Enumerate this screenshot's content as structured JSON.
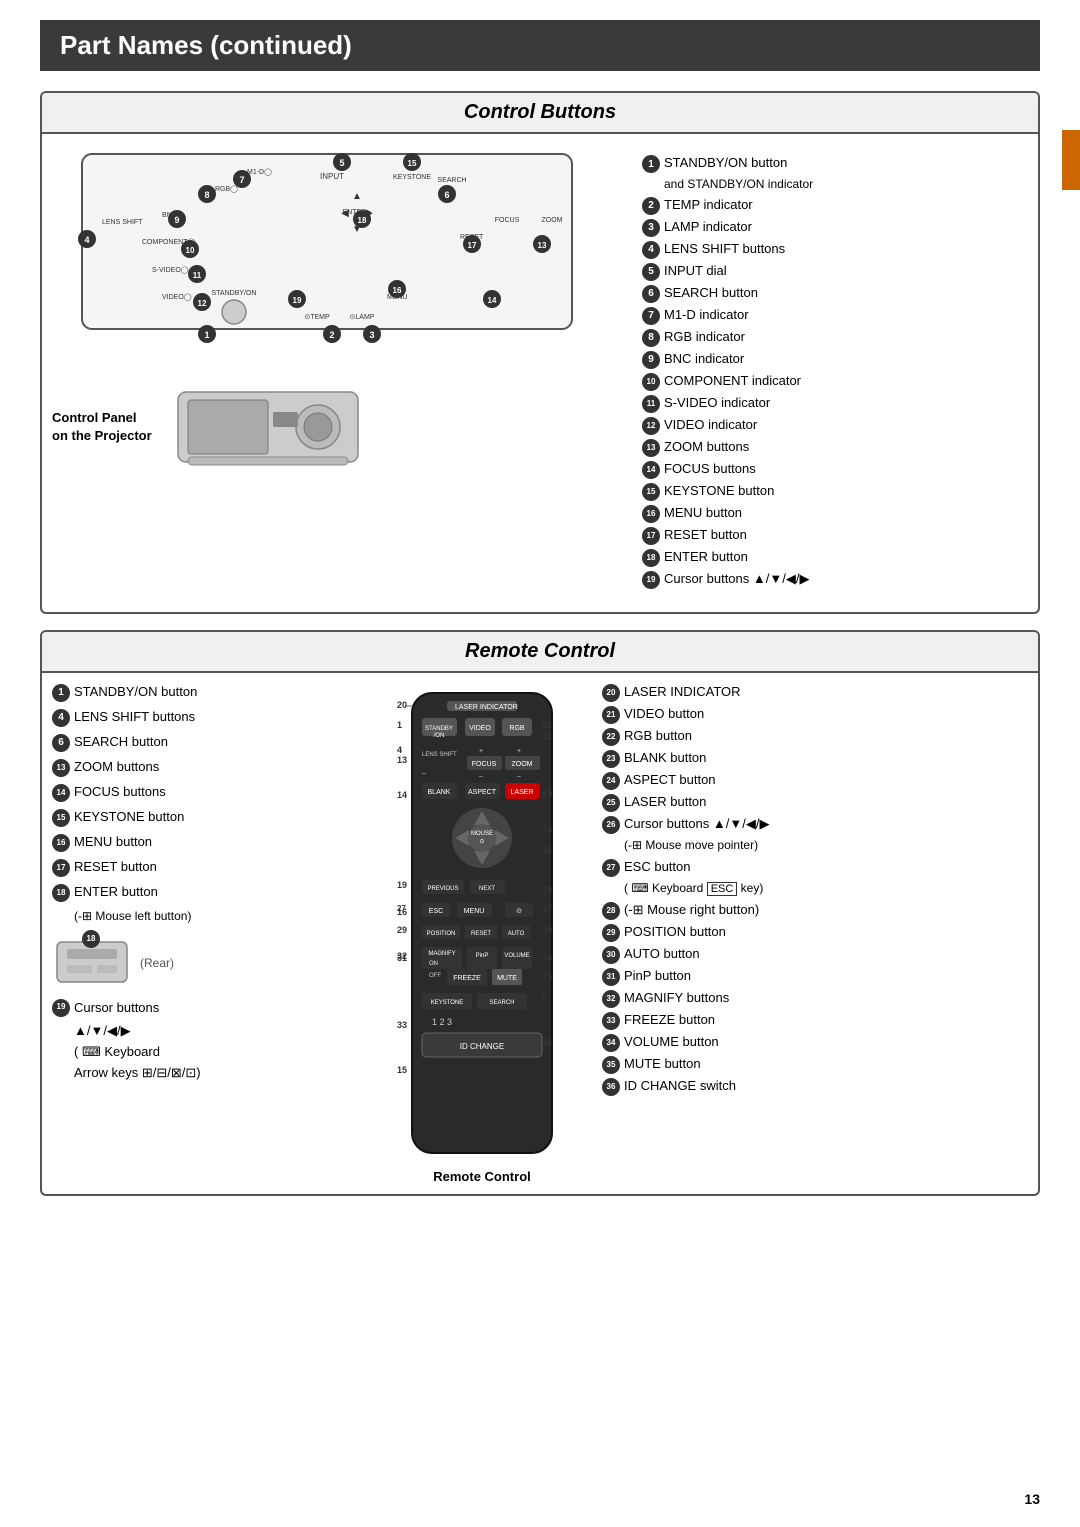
{
  "page": {
    "title": "Part Names (continued)",
    "page_number": "13"
  },
  "control_buttons": {
    "section_title": "Control Buttons",
    "panel_label_line1": "Control Panel",
    "panel_label_line2": "on the Projector",
    "items": [
      {
        "num": "1",
        "text": "STANDBY/ON button"
      },
      {
        "num": "1",
        "text": "and STANDBY/ON indicator"
      },
      {
        "num": "2",
        "text": "TEMP indicator"
      },
      {
        "num": "3",
        "text": "LAMP indicator"
      },
      {
        "num": "4",
        "text": "LENS SHIFT buttons"
      },
      {
        "num": "5",
        "text": "INPUT dial"
      },
      {
        "num": "6",
        "text": "SEARCH button"
      },
      {
        "num": "7",
        "text": "M1-D indicator"
      },
      {
        "num": "8",
        "text": "RGB indicator"
      },
      {
        "num": "9",
        "text": "BNC indicator"
      },
      {
        "num": "10",
        "text": "COMPONENT indicator"
      },
      {
        "num": "11",
        "text": "S-VIDEO indicator"
      },
      {
        "num": "12",
        "text": "VIDEO indicator"
      },
      {
        "num": "13",
        "text": "ZOOM buttons"
      },
      {
        "num": "14",
        "text": "FOCUS buttons"
      },
      {
        "num": "15",
        "text": "KEYSTONE button"
      },
      {
        "num": "16",
        "text": "MENU button"
      },
      {
        "num": "17",
        "text": "RESET button"
      },
      {
        "num": "18",
        "text": "ENTER button"
      },
      {
        "num": "19",
        "text": "Cursor buttons ▲/▼/◀/▶"
      }
    ]
  },
  "remote_control": {
    "section_title": "Remote Control",
    "caption": "Remote Control",
    "left_items": [
      {
        "num": "1",
        "text": "STANDBY/ON button"
      },
      {
        "num": "4",
        "text": "LENS SHIFT buttons"
      },
      {
        "num": "6",
        "text": "SEARCH button"
      },
      {
        "num": "13",
        "text": "ZOOM buttons"
      },
      {
        "num": "14",
        "text": "FOCUS buttons"
      },
      {
        "num": "15",
        "text": "KEYSTONE button"
      },
      {
        "num": "16",
        "text": "MENU button"
      },
      {
        "num": "17",
        "text": "RESET button"
      },
      {
        "num": "18",
        "text": "ENTER button"
      },
      {
        "num": "18",
        "text": "(-D Mouse left button)"
      },
      {
        "num": "18",
        "sub": true,
        "text": "(Rear)"
      },
      {
        "num": "19",
        "text": "Cursor buttons"
      },
      {
        "num": "19",
        "sub": true,
        "text": "▲/▼/◀/▶"
      },
      {
        "num": "19",
        "sub": true,
        "text": "( ⌨ Keyboard"
      },
      {
        "num": "19",
        "sub": true,
        "text": "Arrow keys ⊞/⊟/⊠/⊡)"
      }
    ],
    "right_items": [
      {
        "num": "20",
        "text": "LASER INDICATOR"
      },
      {
        "num": "21",
        "text": "VIDEO button"
      },
      {
        "num": "22",
        "text": "RGB button"
      },
      {
        "num": "23",
        "text": "BLANK button"
      },
      {
        "num": "24",
        "text": "ASPECT button"
      },
      {
        "num": "25",
        "text": "LASER button"
      },
      {
        "num": "26",
        "text": "Cursor buttons ▲/▼/◀/▶"
      },
      {
        "num": "26",
        "sub": true,
        "text": "(-D Mouse move pointer)"
      },
      {
        "num": "27",
        "text": "ESC button"
      },
      {
        "num": "27",
        "sub": true,
        "text": "( ⌨ Keyboard ESC key)"
      },
      {
        "num": "28",
        "text": "(-D Mouse right button)"
      },
      {
        "num": "29",
        "text": "POSITION button"
      },
      {
        "num": "30",
        "text": "AUTO button"
      },
      {
        "num": "31",
        "text": "PinP button"
      },
      {
        "num": "32",
        "text": "MAGNIFY buttons"
      },
      {
        "num": "33",
        "text": "FREEZE button"
      },
      {
        "num": "34",
        "text": "VOLUME button"
      },
      {
        "num": "35",
        "text": "MUTE button"
      },
      {
        "num": "36",
        "text": "ID CHANGE switch"
      }
    ]
  }
}
